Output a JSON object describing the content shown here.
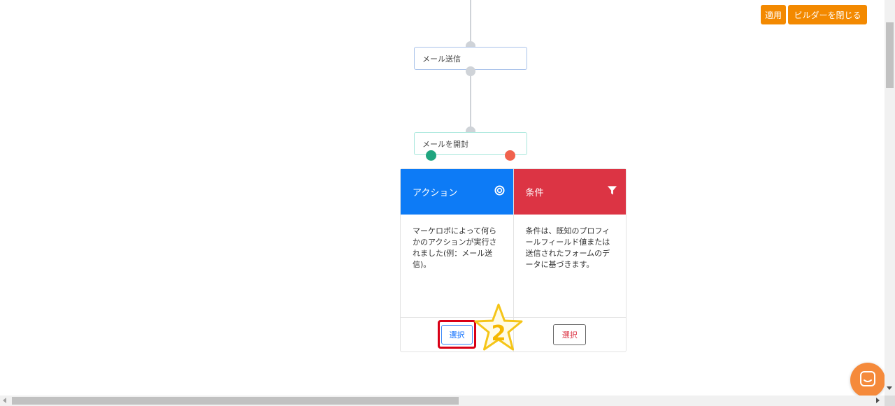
{
  "toolbar": {
    "apply_label": "適用",
    "close_builder_label": "ビルダーを閉じる"
  },
  "nodes": {
    "send_email": "メール送信",
    "open_email": "メールを開封"
  },
  "panel": {
    "action": {
      "title": "アクション",
      "icon": "target-icon",
      "description": "マーケロボによって何らかのアクションが実行されました(例：メール送信)。",
      "select_label": "選択"
    },
    "condition": {
      "title": "条件",
      "icon": "filter-icon",
      "description": "条件は、既知のプロフィールフィールド値または送信されたフォームのデータに基づきます。",
      "select_label": "選択"
    }
  },
  "annotation": {
    "step_number": "2"
  },
  "colors": {
    "orange": "#f38900",
    "action_blue": "#0d7bf6",
    "condition_red": "#dc3444",
    "yes_port": "#1fa57f",
    "no_port": "#f0624d",
    "highlight_red": "#d90016",
    "star_yellow": "#f5c518"
  }
}
